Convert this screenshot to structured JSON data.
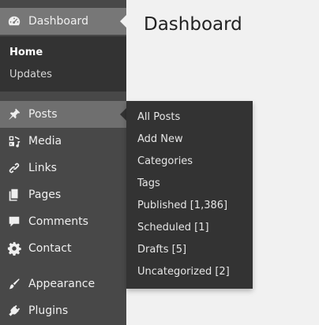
{
  "page": {
    "title": "Dashboard"
  },
  "sidebar": {
    "dashboard": {
      "label": "Dashboard",
      "icon": "dashboard-icon",
      "submenu": [
        {
          "label": "Home",
          "current": true
        },
        {
          "label": "Updates",
          "current": false
        }
      ]
    },
    "items": [
      {
        "label": "Posts",
        "icon": "pin-icon"
      },
      {
        "label": "Media",
        "icon": "media-icon"
      },
      {
        "label": "Links",
        "icon": "link-icon"
      },
      {
        "label": "Pages",
        "icon": "pages-icon"
      },
      {
        "label": "Comments",
        "icon": "comment-icon"
      },
      {
        "label": "Contact",
        "icon": "gear-icon"
      },
      {
        "label": "Appearance",
        "icon": "brush-icon"
      },
      {
        "label": "Plugins",
        "icon": "plug-icon"
      }
    ]
  },
  "flyout": {
    "parent": "Posts",
    "items": [
      "All Posts",
      "Add New",
      "Categories",
      "Tags",
      "Published [1,386]",
      "Scheduled [1]",
      "Drafts [5]",
      "Uncategorized [2]"
    ]
  },
  "colors": {
    "sidebar_bg": "#484848",
    "submenu_bg": "#333333",
    "active_bg": "#777777",
    "page_bg": "#f1f1f1"
  }
}
